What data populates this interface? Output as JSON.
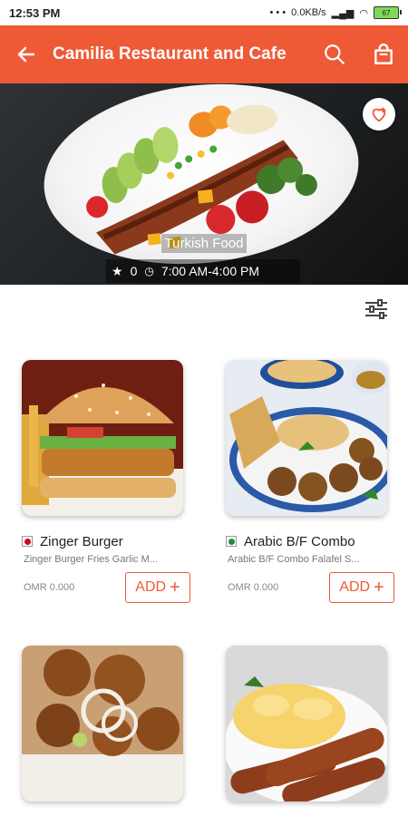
{
  "status_bar": {
    "time": "12:53 PM",
    "network_speed": "0.0KB/s",
    "battery": "67"
  },
  "app_bar": {
    "title": "Camilia Restaurant and Cafe",
    "back_icon": "arrow-left-icon",
    "search_icon": "search-icon",
    "cart_icon": "shopping-bag-icon"
  },
  "hero": {
    "cuisine": "Turkish Food",
    "rating": "0",
    "hours": "7:00 AM-4:00 PM",
    "favorite_icon": "heart-plus-icon"
  },
  "filter_icon": "sliders-icon",
  "colors": {
    "accent": "#ee5a36",
    "non_veg": "#d0021b",
    "veg": "#1e8e3e"
  },
  "menu_items": [
    {
      "name": "Zinger Burger",
      "description": "Zinger Burger Fries Garlic M...",
      "price": "OMR 0.000",
      "add_label": "ADD",
      "type": "non-veg"
    },
    {
      "name": "Arabic B/F Combo",
      "description": "Arabic B/F Combo Falafel S...",
      "price": "OMR 0.000",
      "add_label": "ADD",
      "type": "veg"
    },
    {
      "name": "",
      "description": "",
      "price": "",
      "add_label": "",
      "type": ""
    },
    {
      "name": "",
      "description": "",
      "price": "",
      "add_label": "",
      "type": ""
    }
  ]
}
